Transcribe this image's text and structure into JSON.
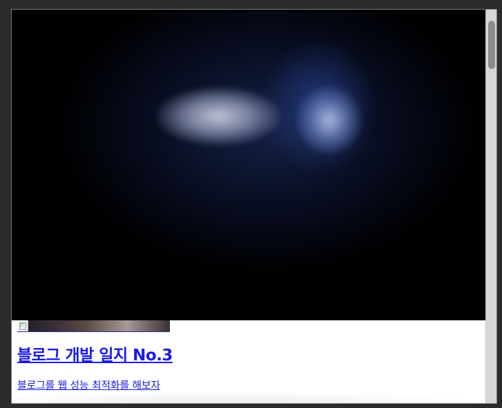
{
  "post": {
    "title": "블로그 개발 일지 No.3",
    "description": "블로그를 웹 성능 최적화를 해보자"
  },
  "icons": {
    "broken_image": "broken-image-icon"
  },
  "colors": {
    "link": "#1a1ae6",
    "hero_background": "#000000",
    "scrollbar_track": "#d6d6d6",
    "scrollbar_thumb": "#8b8b8b"
  }
}
